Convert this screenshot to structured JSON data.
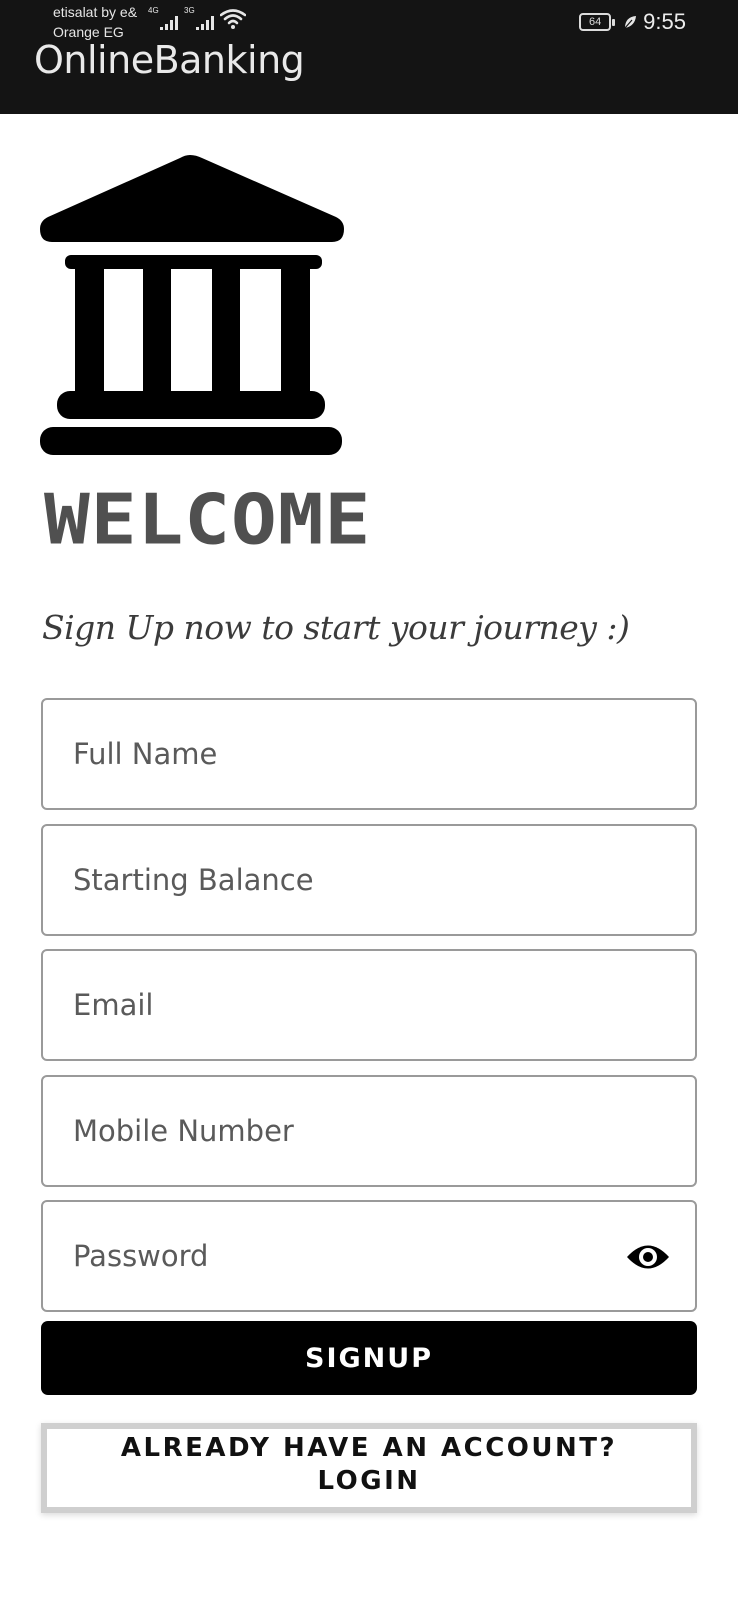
{
  "status_bar": {
    "carrier_primary": "etisalat by e&",
    "carrier_secondary": "Orange EG",
    "network_1": "4G",
    "network_2": "3G",
    "battery_level": "64",
    "time": "9:55"
  },
  "app_bar": {
    "title": "OnlineBanking"
  },
  "hero": {
    "logo_icon": "bank-icon",
    "heading": "WELCOME",
    "tagline": "Sign Up now to start your journey :)"
  },
  "form": {
    "full_name": {
      "placeholder": "Full Name",
      "value": ""
    },
    "starting_balance": {
      "placeholder": "Starting Balance",
      "value": ""
    },
    "email": {
      "placeholder": "Email",
      "value": ""
    },
    "mobile_number": {
      "placeholder": "Mobile Number",
      "value": ""
    },
    "password": {
      "placeholder": "Password",
      "value": "",
      "toggle_icon": "eye-icon"
    }
  },
  "actions": {
    "signup_label": "SIGNUP",
    "login_line_1": "ALREADY HAVE AN ACCOUNT?",
    "login_line_2": "LOGIN"
  },
  "colors": {
    "header_bg": "#141414",
    "primary_button": "#000000",
    "heading_text": "#505050",
    "field_border": "#9a9a9a"
  }
}
